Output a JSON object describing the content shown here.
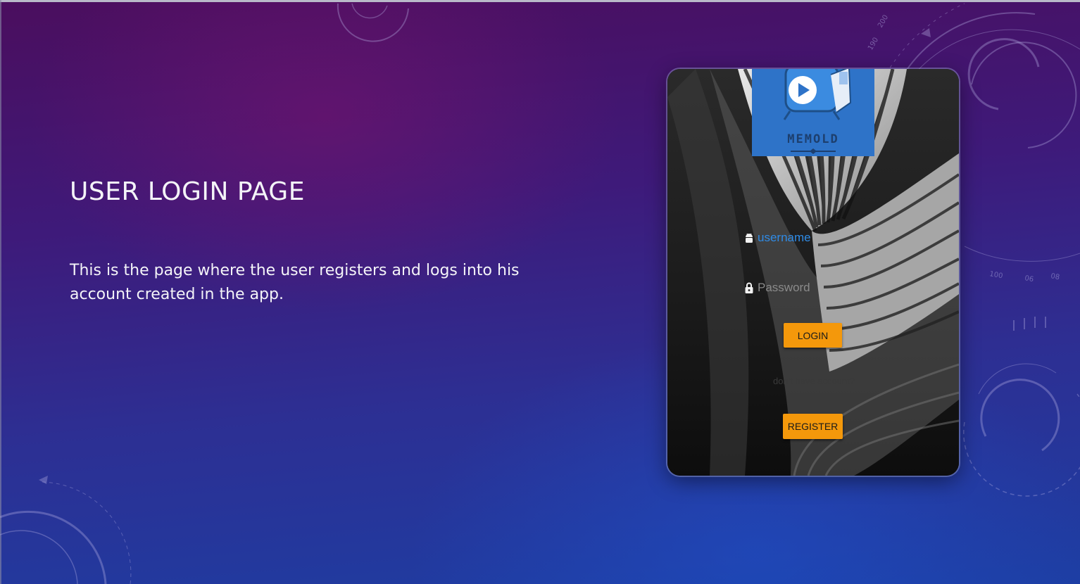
{
  "slide": {
    "title": "USER LOGIN PAGE",
    "body": "This is the page where the user registers and logs into his account created in the app."
  },
  "app": {
    "logo_text": "MEMOLD",
    "username_placeholder": "username",
    "password_placeholder": "Password",
    "login_label": "LOGIN",
    "no_account_text": "don't have account?",
    "register_label": "REGISTER",
    "accent_color": "#f4980b",
    "logo_color": "#2e73c8"
  },
  "decor": {
    "dial_numbers": [
      "190",
      "200",
      "100",
      "06",
      "08"
    ]
  }
}
